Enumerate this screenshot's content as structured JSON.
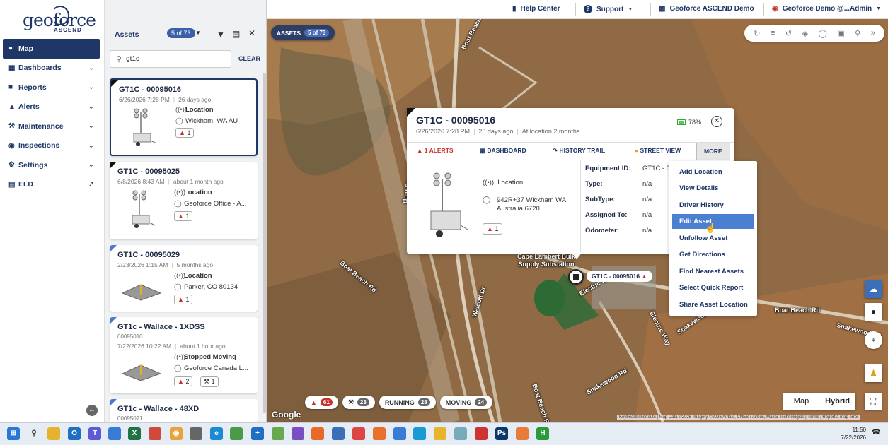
{
  "logo": {
    "wordmark": "geoforce",
    "sub": "ASCEND"
  },
  "nav": {
    "items": [
      {
        "label": "Map",
        "icon": "map-pin-icon",
        "active": true
      },
      {
        "label": "Dashboards",
        "icon": "dashboard-icon"
      },
      {
        "label": "Reports",
        "icon": "report-icon"
      },
      {
        "label": "Alerts",
        "icon": "alert-icon"
      },
      {
        "label": "Maintenance",
        "icon": "wrench-icon"
      },
      {
        "label": "Inspections",
        "icon": "inspection-icon"
      },
      {
        "label": "Settings",
        "icon": "gear-icon"
      },
      {
        "label": "ELD",
        "icon": "eld-icon"
      }
    ]
  },
  "topbar": {
    "help": "Help Center",
    "support": "Support",
    "account": "Geoforce ASCEND Demo",
    "user": "Geoforce Demo @...Admin"
  },
  "panel": {
    "title": "Assets",
    "count_badge": "5 of 73",
    "search_value": "gt1c",
    "clear_label": "CLEAR",
    "cards": [
      {
        "name": "GT1C - 00095016",
        "datetime": "6/26/2026 7:28 PM",
        "ago": "26 days ago",
        "status": "Location",
        "location": "Wickham, WA AU",
        "alerts": "1"
      },
      {
        "name": "GT1C - 00095025",
        "datetime": "6/8/2026 8:43 AM",
        "ago": "about 1 month ago",
        "status": "Location",
        "location": "Geoforce Office - A...",
        "alerts": "1"
      },
      {
        "name": "GT1C - 00095029",
        "datetime": "2/23/2026 1:15 AM",
        "ago": "5 months ago",
        "status": "Location",
        "location": "Parker, CO 80134",
        "alerts": "1"
      },
      {
        "name": "GT1c - Wallace - 1XDSS",
        "subid": "00095010",
        "datetime": "7/22/2026 10:22 AM",
        "ago": "about 1 hour ago",
        "status": "Stopped Moving",
        "location": "Geoforce Canada L...",
        "alerts": "2",
        "maint": "1"
      },
      {
        "name": "GT1c - Wallace - 48XD",
        "subid": "00095021"
      }
    ]
  },
  "map": {
    "assets_button": "ASSETS",
    "assets_badge": "5 of 73",
    "labels": {
      "r1": "Boat Beach Rd",
      "r2": "Boat Beach Rd",
      "r3": "Boat Beach Rd",
      "r4": "Walcott Dr",
      "r5": "Electric Way",
      "r6": "Electric Way",
      "r7": "Snakewood Rd",
      "r8": "Snakewood Rd",
      "r9": "Snakewood Rd",
      "r10": "Boat Beach Rd",
      "r11": "Cape Lambert Bulk Supply Substation",
      "r12": "Boat Beach Rd"
    },
    "marker_label": "GT1C - 00095016",
    "chips": {
      "alerts": "61",
      "maint": "23",
      "running_label": "RUNNING",
      "running": "28",
      "moving_label": "MOVING",
      "moving": "24"
    },
    "maptype": {
      "map": "Map",
      "hybrid": "Hybrid"
    },
    "google": "Google",
    "attribution": "Keyboard shortcuts | Map Data ©2026 Imagery ©2026 Airbus, CNES / Airbus, Maxar Technologies | Terms | Report a map error"
  },
  "popup": {
    "title": "GT1C - 00095016",
    "datetime": "6/26/2026 7:28 PM",
    "ago": "26 days ago",
    "at_location": "At location 2 months",
    "battery": "78%",
    "tabs": {
      "alerts": "1 ALERTS",
      "dashboard": "DASHBOARD",
      "history": "HISTORY TRAIL",
      "street": "STREET VIEW",
      "more": "MORE"
    },
    "status": "Location",
    "address": "942R+37 Wickham WA, Australia 6720",
    "alerts": "1",
    "fields": [
      {
        "label": "Equipment ID:",
        "value": "GT1C - 00"
      },
      {
        "label": "Type:",
        "value": "n/a"
      },
      {
        "label": "SubType:",
        "value": "n/a"
      },
      {
        "label": "Assigned To:",
        "value": "n/a"
      },
      {
        "label": "Odometer:",
        "value": "n/a"
      }
    ]
  },
  "more_menu": [
    "Add Location",
    "View Details",
    "Driver History",
    "Edit Asset",
    "Unfollow Asset",
    "Get Directions",
    "Find Nearest Assets",
    "Select Quick Report",
    "Share Asset Location"
  ],
  "taskbar": {
    "time": "11:50",
    "date": "7/22/2026"
  }
}
